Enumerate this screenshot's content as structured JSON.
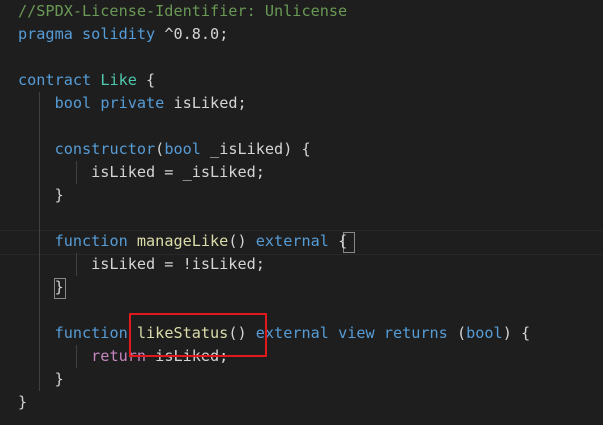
{
  "editor": {
    "lines": [
      {
        "id": "l1",
        "tokens": [
          {
            "t": "//SPDX-License-Identifier: Unlicense",
            "c": "comment"
          }
        ]
      },
      {
        "id": "l2",
        "tokens": [
          {
            "t": "pragma",
            "c": "kw"
          },
          {
            "t": " ",
            "c": "plain"
          },
          {
            "t": "solidity",
            "c": "kw"
          },
          {
            "t": " ^0.8.0;",
            "c": "plain"
          }
        ]
      },
      {
        "id": "l3",
        "tokens": []
      },
      {
        "id": "l4",
        "tokens": [
          {
            "t": "contract",
            "c": "kw"
          },
          {
            "t": " ",
            "c": "plain"
          },
          {
            "t": "Like",
            "c": "type"
          },
          {
            "t": " {",
            "c": "plain"
          }
        ]
      },
      {
        "id": "l5",
        "tokens": [
          {
            "t": "    ",
            "c": "plain"
          },
          {
            "t": "bool",
            "c": "kw"
          },
          {
            "t": " ",
            "c": "plain"
          },
          {
            "t": "private",
            "c": "kw"
          },
          {
            "t": " isLiked;",
            "c": "plain"
          }
        ]
      },
      {
        "id": "l6",
        "tokens": []
      },
      {
        "id": "l7",
        "tokens": [
          {
            "t": "    ",
            "c": "plain"
          },
          {
            "t": "constructor",
            "c": "kw"
          },
          {
            "t": "(",
            "c": "plain"
          },
          {
            "t": "bool",
            "c": "kw"
          },
          {
            "t": " _isLiked) {",
            "c": "plain"
          }
        ]
      },
      {
        "id": "l8",
        "tokens": [
          {
            "t": "        isLiked = _isLiked;",
            "c": "plain"
          }
        ]
      },
      {
        "id": "l9",
        "tokens": [
          {
            "t": "    }",
            "c": "plain"
          }
        ]
      },
      {
        "id": "l10",
        "tokens": []
      },
      {
        "id": "l11",
        "tokens": [
          {
            "t": "    ",
            "c": "plain"
          },
          {
            "t": "function",
            "c": "kw"
          },
          {
            "t": " ",
            "c": "plain"
          },
          {
            "t": "manageLike",
            "c": "fn"
          },
          {
            "t": "() ",
            "c": "plain"
          },
          {
            "t": "external",
            "c": "kw"
          },
          {
            "t": " {",
            "c": "plain"
          }
        ]
      },
      {
        "id": "l12",
        "tokens": [
          {
            "t": "        isLiked = !isLiked;",
            "c": "plain"
          }
        ]
      },
      {
        "id": "l13",
        "tokens": [
          {
            "t": "    }",
            "c": "plain"
          }
        ]
      },
      {
        "id": "l14",
        "tokens": []
      },
      {
        "id": "l15",
        "tokens": [
          {
            "t": "    ",
            "c": "plain"
          },
          {
            "t": "function",
            "c": "kw"
          },
          {
            "t": " ",
            "c": "plain"
          },
          {
            "t": "likeStatus",
            "c": "fn"
          },
          {
            "t": "() ",
            "c": "plain"
          },
          {
            "t": "external",
            "c": "kw"
          },
          {
            "t": " ",
            "c": "plain"
          },
          {
            "t": "view",
            "c": "kw"
          },
          {
            "t": " ",
            "c": "plain"
          },
          {
            "t": "returns",
            "c": "kw"
          },
          {
            "t": " (",
            "c": "plain"
          },
          {
            "t": "bool",
            "c": "kw"
          },
          {
            "t": ") {",
            "c": "plain"
          }
        ]
      },
      {
        "id": "l16",
        "tokens": [
          {
            "t": "        ",
            "c": "plain"
          },
          {
            "t": "return",
            "c": "ctrl"
          },
          {
            "t": " isLiked;",
            "c": "plain"
          }
        ]
      },
      {
        "id": "l17",
        "tokens": [
          {
            "t": "    }",
            "c": "plain"
          }
        ]
      },
      {
        "id": "l18",
        "tokens": [
          {
            "t": "}",
            "c": "plain"
          }
        ]
      }
    ]
  },
  "colors": {
    "background": "#1e1e1e",
    "comment": "#6a9955",
    "keyword": "#569cd6",
    "type": "#4ec9b0",
    "function": "#dcdcaa",
    "plain": "#d4d4d4",
    "control": "#c586c0",
    "highlight_box": "#e0191d"
  }
}
